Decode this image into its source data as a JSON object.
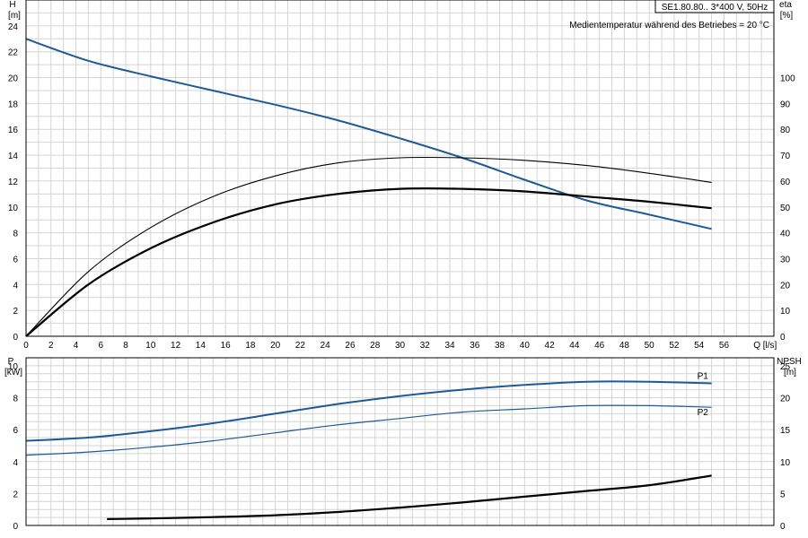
{
  "chart_data": [
    {
      "type": "line",
      "info_box": "SE1.80.80.. 3*400 V, 50Hz",
      "annotation": "Medientemperatur während des Betriebes = 20 °C",
      "x_label": "Q [l/s]",
      "x_ticks": [
        "0",
        "2",
        "4",
        "6",
        "8",
        "10",
        "12",
        "14",
        "16",
        "18",
        "20",
        "22",
        "24",
        "26",
        "28",
        "30",
        "32",
        "34",
        "36",
        "38",
        "40",
        "42",
        "44",
        "46",
        "48",
        "50",
        "52",
        "54",
        "56"
      ],
      "xlim": [
        0,
        60
      ],
      "y_left_label": [
        "H",
        "[m]"
      ],
      "y_left_ticks": [
        "0",
        "2",
        "4",
        "6",
        "8",
        "10",
        "12",
        "14",
        "16",
        "18",
        "20",
        "22",
        "24"
      ],
      "y_left_lim": [
        0,
        26
      ],
      "y_right_label": [
        "eta",
        "[%]"
      ],
      "y_right_ticks": [
        "0",
        "10",
        "20",
        "30",
        "40",
        "50",
        "60",
        "70",
        "80",
        "90",
        "100"
      ],
      "y_right_lim": [
        0,
        130
      ],
      "grid": true,
      "series": [
        {
          "axis": "left",
          "color": "#1f5a96",
          "x": [
            0,
            5,
            10,
            15,
            20,
            25,
            30,
            35,
            40,
            45,
            50,
            55
          ],
          "y": [
            23.0,
            21.3,
            20.1,
            19.0,
            17.9,
            16.7,
            15.3,
            13.8,
            12.1,
            10.5,
            9.4,
            8.3
          ]
        },
        {
          "axis": "right",
          "color": "#000000",
          "x": [
            0,
            5,
            10,
            15,
            20,
            25,
            30,
            35,
            40,
            45,
            50,
            55
          ],
          "y": [
            0,
            25,
            42,
            54,
            62,
            67,
            69,
            69,
            68,
            66,
            63,
            59.5
          ]
        },
        {
          "axis": "right",
          "color": "#000000",
          "bold": true,
          "x": [
            0,
            5,
            10,
            15,
            20,
            25,
            30,
            35,
            40,
            45,
            50,
            55
          ],
          "y": [
            0,
            20,
            34,
            44,
            51,
            55,
            57,
            57,
            56,
            54,
            52,
            49.5
          ]
        }
      ]
    },
    {
      "type": "line",
      "y_left_label": [
        "P",
        "[kW]"
      ],
      "y_left_ticks": [
        "0",
        "2",
        "4",
        "6",
        "8",
        "10"
      ],
      "y_left_lim": [
        0,
        10.5
      ],
      "y_right_label": [
        "NPSH",
        "[m]"
      ],
      "y_right_ticks": [
        "0",
        "5",
        "10",
        "15",
        "20",
        "25"
      ],
      "y_right_lim": [
        0,
        26.25
      ],
      "xlim": [
        0,
        60
      ],
      "grid": true,
      "series": [
        {
          "name": "P1",
          "axis": "left",
          "color": "#1f5a96",
          "x": [
            0,
            5,
            10,
            15,
            20,
            25,
            30,
            35,
            40,
            45,
            50,
            55
          ],
          "y": [
            5.3,
            5.5,
            5.9,
            6.4,
            7.0,
            7.6,
            8.1,
            8.5,
            8.8,
            9.0,
            9.0,
            8.9
          ]
        },
        {
          "name": "P2",
          "axis": "left",
          "color": "#1f5a96",
          "x": [
            0,
            5,
            10,
            15,
            20,
            25,
            30,
            35,
            40,
            45,
            50,
            55
          ],
          "y": [
            4.4,
            4.6,
            4.9,
            5.3,
            5.8,
            6.3,
            6.7,
            7.1,
            7.3,
            7.5,
            7.5,
            7.4
          ]
        },
        {
          "name": "",
          "axis": "right",
          "color": "#000000",
          "bold": true,
          "x": [
            6.5,
            10,
            15,
            20,
            25,
            30,
            35,
            40,
            45,
            50,
            55
          ],
          "y": [
            1.0,
            1.1,
            1.3,
            1.6,
            2.1,
            2.8,
            3.6,
            4.5,
            5.4,
            6.3,
            7.8
          ]
        }
      ]
    }
  ]
}
